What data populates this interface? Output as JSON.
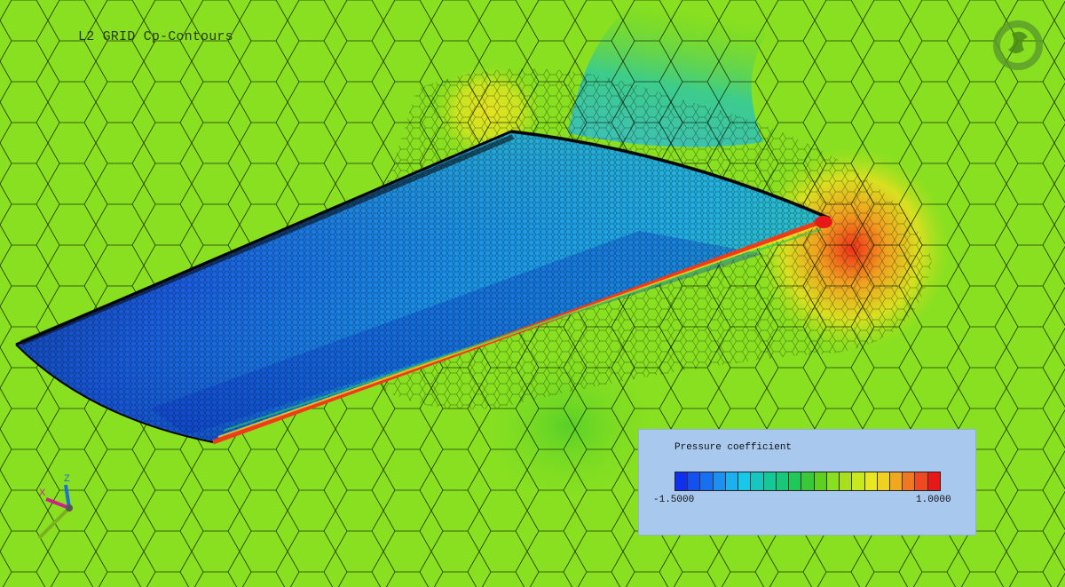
{
  "view": {
    "title": "L2 GRID Cp-Contours",
    "background_color": "#88e020",
    "mesh_line_color": "#0b1a05"
  },
  "legend": {
    "title": "Pressure coefficient",
    "min_label": "-1.5000",
    "max_label": "1.0000",
    "min_value": -1.5,
    "max_value": 1.0,
    "bands": 21,
    "colors": [
      "#1030f0",
      "#1450f0",
      "#1870f0",
      "#1c90f0",
      "#1cb0f0",
      "#18c8e8",
      "#14c8c0",
      "#14c898",
      "#18c878",
      "#20c858",
      "#38c838",
      "#60d020",
      "#88e020",
      "#a8e020",
      "#c8e820",
      "#e8e820",
      "#f0d020",
      "#f0a820",
      "#f07820",
      "#f04820",
      "#e81818"
    ],
    "background_color": "#a8c8ee"
  },
  "logo": {
    "icon": "solver-logo-icon"
  },
  "axis_triad": {
    "icon": "axis-triad-icon",
    "labels": {
      "x": "X",
      "z": "Z"
    },
    "colors": {
      "x": "#d0208a",
      "y": "#7ab020",
      "z": "#1c70d8"
    }
  }
}
